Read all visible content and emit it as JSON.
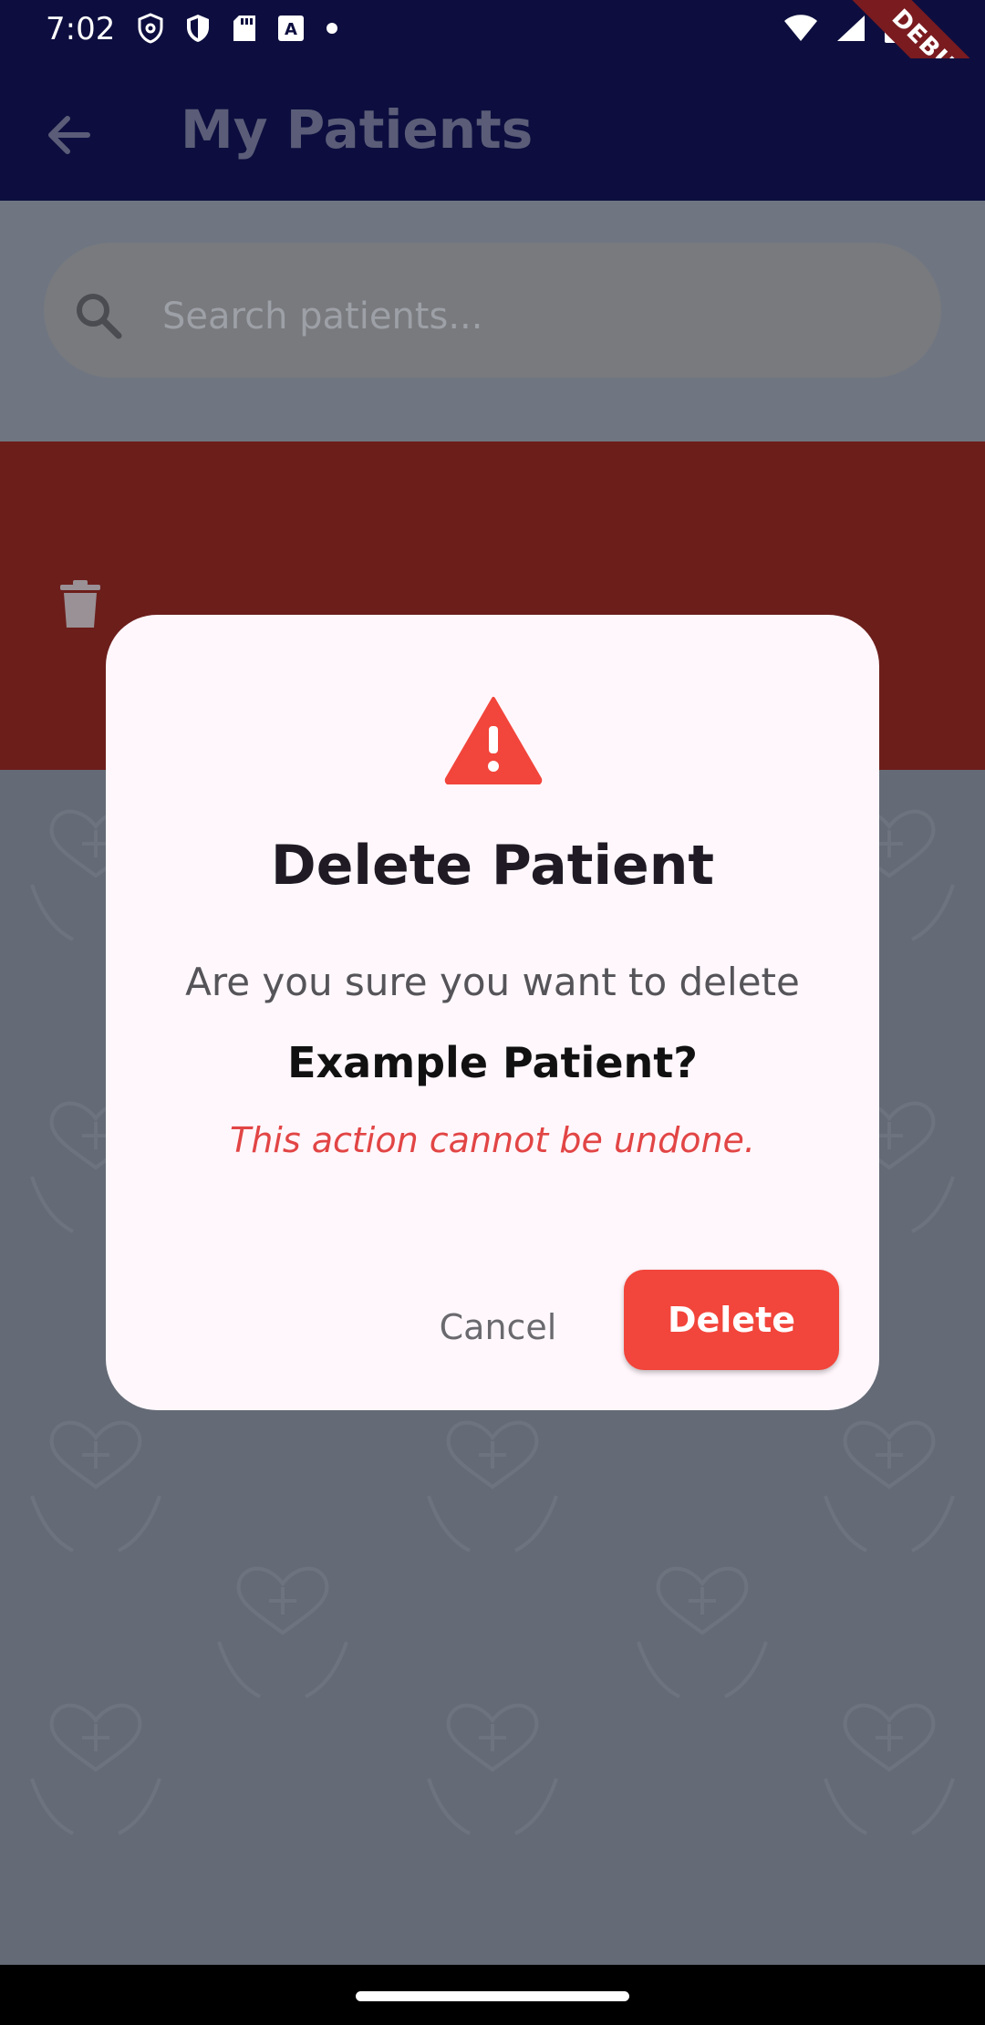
{
  "status_bar": {
    "time": "7:02",
    "icons_left": [
      "shield-outline-icon",
      "shield-half-icon",
      "sd-card-icon",
      "a-box-icon",
      "dot-icon"
    ],
    "icons_right": [
      "wifi-icon",
      "signal-icon",
      "battery-icon"
    ],
    "debug_label": "DEBUG"
  },
  "app_bar": {
    "title": "My Patients",
    "back_icon": "arrow-back-icon"
  },
  "search": {
    "placeholder": "Search patients...",
    "value": ""
  },
  "swipe_action": {
    "icon": "trash-icon",
    "color": "#6c1e1b"
  },
  "dialog": {
    "icon": "warning-icon",
    "title": "Delete Patient",
    "message": "Are you sure you want to delete",
    "patient_name": "Example Patient?",
    "warning": "This action cannot be undone.",
    "cancel_label": "Cancel",
    "delete_label": "Delete",
    "accent_color": "#f2453b"
  },
  "background_pattern_icon": "heart-hands-plus-icon"
}
